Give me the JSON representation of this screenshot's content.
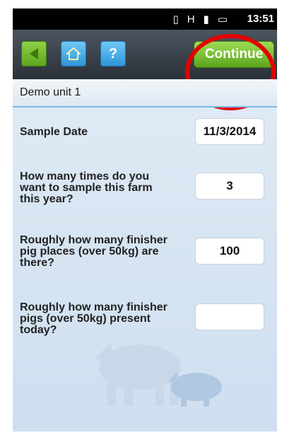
{
  "status_bar": {
    "time": "13:51"
  },
  "toolbar": {
    "back_icon": "back-arrow-icon",
    "home_icon": "home-icon",
    "help_label": "?",
    "continue_label": "Continue"
  },
  "unit": {
    "title": "Demo unit 1"
  },
  "questions": [
    {
      "label": "Sample Date",
      "value": "11/3/2014"
    },
    {
      "label": "How many times do you want to sample this farm this year?",
      "value": "3"
    },
    {
      "label": "Roughly how many finisher pig places (over 50kg) are there?",
      "value": "100"
    },
    {
      "label": "Roughly how many finisher pigs (over 50kg) present today?",
      "value": ""
    }
  ],
  "colors": {
    "accent_green": "#6bb42a",
    "accent_blue": "#3a9ee0",
    "highlight_red": "#e30000"
  }
}
